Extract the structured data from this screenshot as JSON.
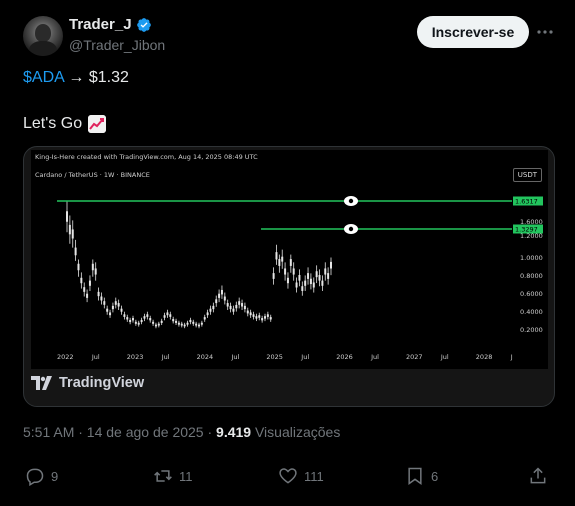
{
  "author": {
    "name": "Trader_J",
    "handle": "@Trader_Jibon",
    "verified": true
  },
  "header": {
    "subscribe_label": "Inscrever-se",
    "more_icon": "more-icon"
  },
  "tweet": {
    "cashtag": "$ADA",
    "arrow": "→",
    "price": "$1.32",
    "line2": "Let's Go",
    "emoji": "chart-increasing-emoji"
  },
  "chart_card": {
    "header_text": "King-Is-Here created with TradingView.com, Aug 14, 2025 08:49 UTC",
    "symbol_text": "Cardano / TetherUS · 1W · BINANCE",
    "currency_label": "USDT",
    "price_ticks": [
      "1.6000",
      "1.2000",
      "1.0000",
      "0.8000",
      "0.6000",
      "0.4000",
      "0.2000"
    ],
    "level_labels": [
      "1.6317",
      "1.3297"
    ],
    "x_ticks": [
      "2022",
      "Jul",
      "2023",
      "Jul",
      "2024",
      "Jul",
      "2025",
      "Jul",
      "2026",
      "Jul",
      "2027",
      "Jul",
      "2028",
      "J"
    ],
    "logo_text": "TradingView",
    "line_color": "#22c55e",
    "candle_color": "#e6e6e6"
  },
  "meta": {
    "time": "5:51 AM · 14 de ago de 2025 · ",
    "views_count": "9.419",
    "views_label": " Visualizações"
  },
  "actions": {
    "replies": "9",
    "reposts": "11",
    "likes": "111",
    "bookmarks": "6"
  },
  "colors": {
    "accent": "#1d9bf0",
    "muted": "#71767b",
    "text": "#e7e9ea"
  }
}
